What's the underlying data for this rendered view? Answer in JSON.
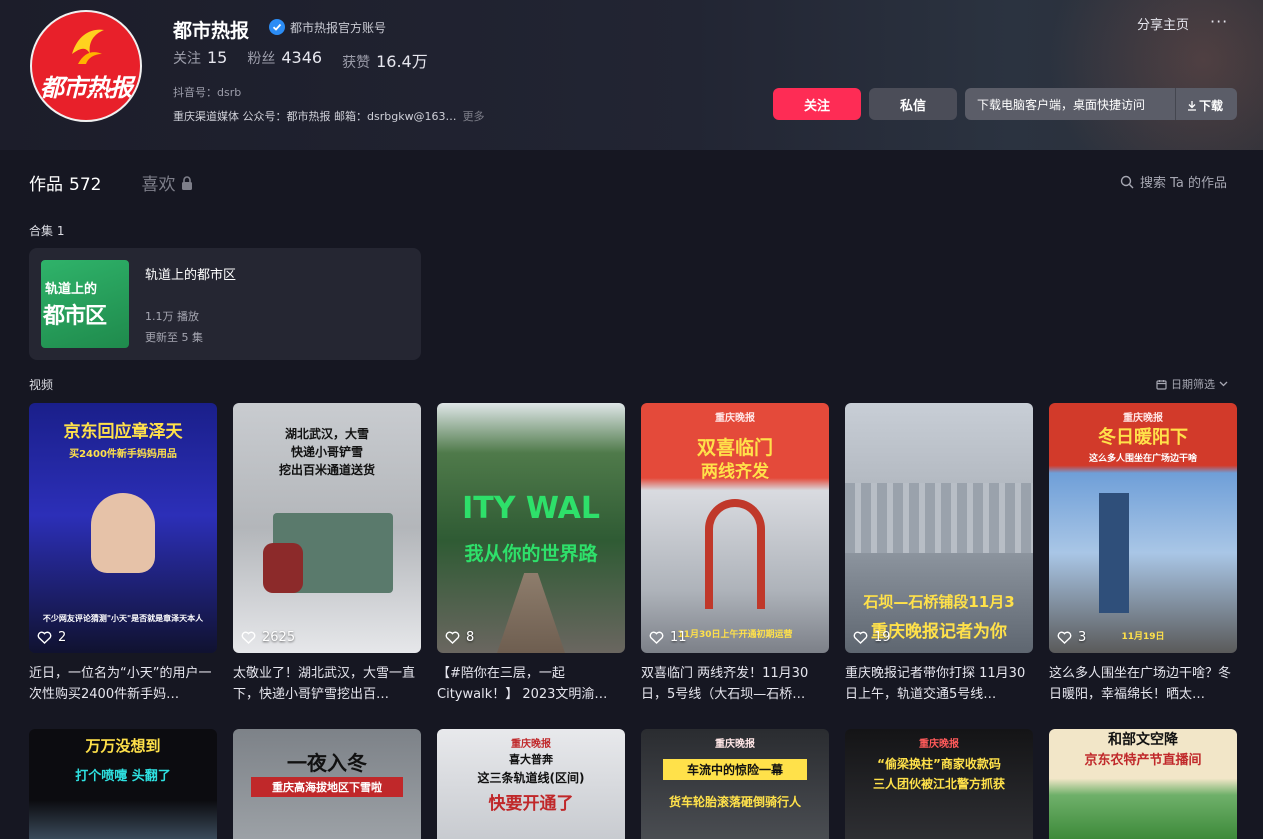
{
  "profile": {
    "avatar_logo_text": "都市热报",
    "name": "都市热报",
    "verified_label": "都市热报官方账号",
    "stats": [
      {
        "label": "关注",
        "value": "15"
      },
      {
        "label": "粉丝",
        "value": "4346"
      },
      {
        "label": "获赞",
        "value": "16.4万"
      }
    ],
    "douyin_id": "抖音号：dsrb",
    "bio": "重庆渠道媒体 公众号：都市热报 邮箱：dsrbgkw@163…",
    "bio_more": "更多"
  },
  "header_actions": {
    "share": "分享主页",
    "more": "···",
    "follow": "关注",
    "message": "私信",
    "download_tip": "下载电脑客户端，桌面快捷访问",
    "download": "下载"
  },
  "tabs": {
    "works_label": "作品",
    "works_count": "572",
    "likes_label": "喜欢",
    "search": "搜索 Ta 的作品"
  },
  "collection": {
    "section_label": "合集 1",
    "thumb_line1": "轨道上的",
    "thumb_line2": "都市区",
    "title": "轨道上的都市区",
    "plays": "1.1万 播放",
    "updated": "更新至 5 集"
  },
  "videos_section": {
    "label": "视频",
    "date_filter": "日期筛选"
  },
  "videos": [
    {
      "likes": "2",
      "overlay_top": "京东回应章泽天",
      "overlay_sub": "买2400件新手妈妈用品",
      "overlay_bottom": "不少网友评论猜测\"小天\"是否就是章泽天本人",
      "caption": "近日，一位名为“小天”的用户一次性购买2400件新手妈…"
    },
    {
      "likes": "2625",
      "overlay_top": "湖北武汉，大雪",
      "overlay_sub": "快递小哥铲雪",
      "overlay_bottom": "挖出百米通道送货",
      "caption": "太敬业了！湖北武汉，大雪一直下，快递小哥铲雪挖出百…"
    },
    {
      "likes": "8",
      "overlay_top": "ITY WAL",
      "overlay_sub": "我从你的世界路",
      "overlay_bottom": "",
      "caption": "【#陪你在三层，一起Citywalk！】 2023文明渝…"
    },
    {
      "likes": "11",
      "brand": "重庆晚报",
      "overlay_top": "双喜临门",
      "overlay_sub": "两线齐发",
      "overlay_bottom": "11月30日上午开通初期运营",
      "caption": "双喜临门 两线齐发！11月30日，5号线（大石坝—石桥…"
    },
    {
      "likes": "19",
      "overlay_top": "石坝—石桥铺段11月3",
      "overlay_sub": "重庆晚报记者为你",
      "overlay_bottom": "",
      "caption": "重庆晚报记者带你打探 11月30日上午，轨道交通5号线…"
    },
    {
      "likes": "3",
      "brand": "重庆晚报",
      "overlay_top": "冬日暖阳下",
      "overlay_sub": "这么多人围坐在广场边干啥",
      "overlay_bottom": "11月19日",
      "caption": "这么多人围坐在广场边干啥？冬日暖阳，幸福绵长！晒太…"
    }
  ],
  "videos_row2": [
    {
      "overlay_top": "万万没想到",
      "overlay_sub": "打个喷嚏 头翻了"
    },
    {
      "overlay_top": "一夜入冬",
      "overlay_sub": "重庆高海拔地区下雪啦"
    },
    {
      "brand": "重庆晚报",
      "overlay_top": "喜大普奔",
      "overlay_sub": "这三条轨道线(区间)",
      "overlay_bottom": "快要开通了"
    },
    {
      "brand": "重庆晚报",
      "overlay_top": "车流中的惊险一幕",
      "overlay_sub": "货车轮胎滚落砸倒骑行人"
    },
    {
      "brand": "重庆晚报",
      "overlay_top": "“偷梁换柱”商家收款码",
      "overlay_sub": "三人团伙被江北警方抓获"
    },
    {
      "overlay_top": "和部文空降",
      "overlay_sub": "京东农特产节直播间"
    }
  ]
}
